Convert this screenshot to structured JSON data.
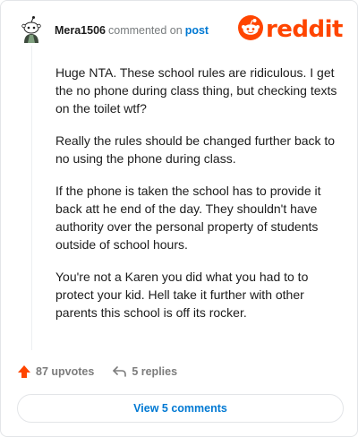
{
  "header": {
    "username": "Mera1506",
    "commented_on": "commented on",
    "post_link": "post",
    "logo_text": "reddit"
  },
  "comment": {
    "paragraphs": [
      "Huge NTA. These school rules are ridiculous. I get the no phone during class thing, but checking texts on the toilet wtf?",
      "Really the rules should be changed further back to no using the phone during class.",
      "If the phone is taken the school has to provide it back att he end of the day. They shouldn't have authority over the personal property of students outside of school hours.",
      "You're not a Karen you did what you had to to protect your kid. Hell take it further with other parents this school is off its rocker."
    ]
  },
  "actions": {
    "upvotes_label": "87 upvotes",
    "replies_label": "5 replies"
  },
  "footer": {
    "view_comments_label": "View 5 comments"
  },
  "colors": {
    "brand": "#ff4500",
    "link": "#0079d3",
    "muted": "#787c7e"
  },
  "icons": {
    "avatar": "snoo-avatar-icon",
    "logo": "reddit-snoo-icon",
    "upvote": "upvote-arrow-icon",
    "reply": "reply-arrow-icon"
  }
}
